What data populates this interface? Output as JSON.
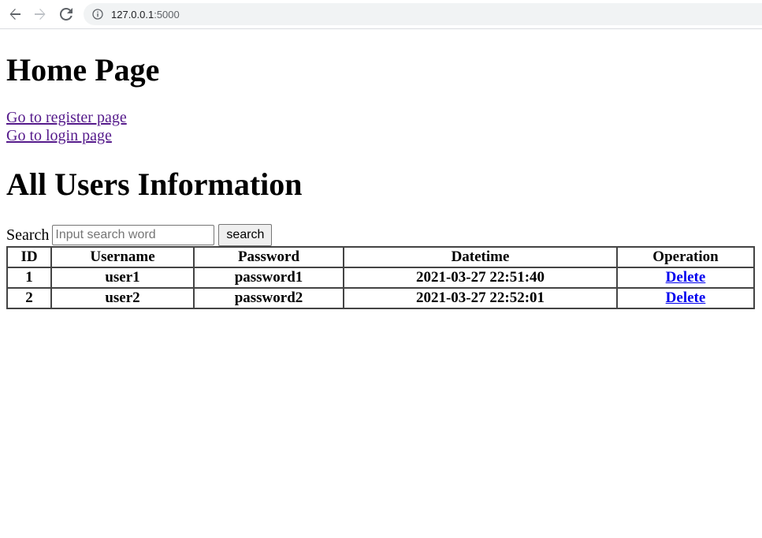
{
  "browser": {
    "url_host": "127.0.0.1",
    "url_port": ":5000"
  },
  "page": {
    "title": "Home Page",
    "links": [
      {
        "label": "Go to register page"
      },
      {
        "label": "Go to login page"
      }
    ],
    "section_title": "All Users Information"
  },
  "search": {
    "label": "Search",
    "placeholder": "Input search word",
    "value": "",
    "button_label": "search"
  },
  "table": {
    "headers": [
      "ID",
      "Username",
      "Password",
      "Datetime",
      "Operation"
    ],
    "rows": [
      {
        "id": "1",
        "username": "user1",
        "password": "password1",
        "datetime": "2021-03-27 22:51:40",
        "operation": "Delete"
      },
      {
        "id": "2",
        "username": "user2",
        "password": "password2",
        "datetime": "2021-03-27 22:52:01",
        "operation": "Delete"
      }
    ]
  },
  "colors": {
    "visited_link": "#551a8b",
    "link": "#0000ee",
    "address_bar_bg": "#f1f3f4"
  },
  "icons": {
    "back": "arrow-left-icon",
    "forward": "arrow-right-icon",
    "reload": "reload-icon",
    "info": "info-icon"
  }
}
